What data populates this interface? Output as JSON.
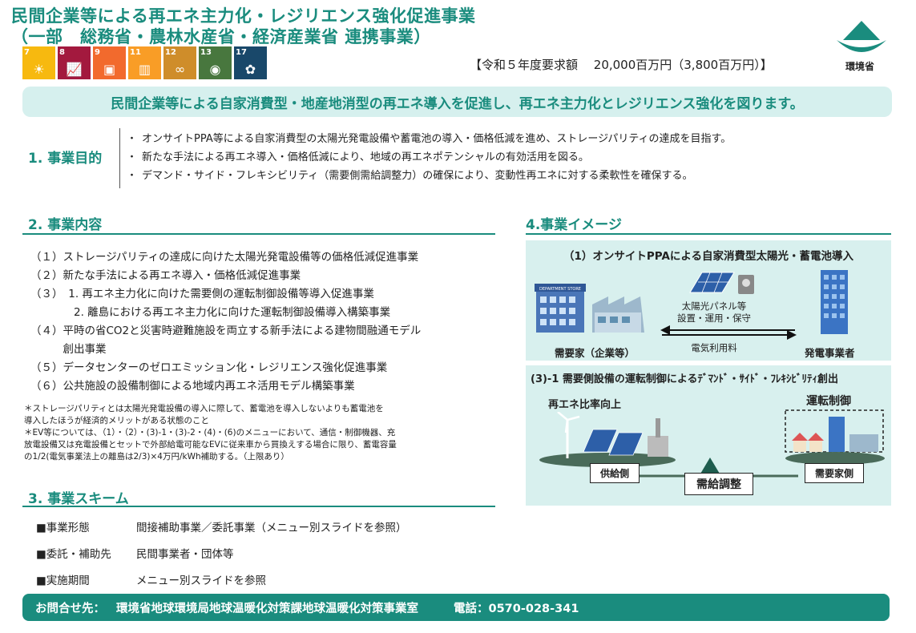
{
  "header": {
    "title_line1": "民間企業等による再エネ主力化・レジリエンス強化促進事業",
    "title_line2": "（一部　総務省・農林水産省・経済産業省 連携事業）",
    "budget": "【令和５年度要求額　 20,000百万円（3,800百万円）】",
    "logo_text": "環境省"
  },
  "sdgs": [
    {
      "num": "7",
      "color": "#f7b90f",
      "glyph": "☀"
    },
    {
      "num": "8",
      "color": "#a3193e",
      "glyph": "📈"
    },
    {
      "num": "9",
      "color": "#f26a2d",
      "glyph": "▣"
    },
    {
      "num": "11",
      "color": "#f99d26",
      "glyph": "▥"
    },
    {
      "num": "12",
      "color": "#cf8d2a",
      "glyph": "∞"
    },
    {
      "num": "13",
      "color": "#48773e",
      "glyph": "◉"
    },
    {
      "num": "17",
      "color": "#19486a",
      "glyph": "✿"
    }
  ],
  "banner": "民間企業等による自家消費型・地産地消型の再エネ導入を促進し、再エネ主力化とレジリエンス強化を図ります。",
  "purpose": {
    "label": "1. 事業目的",
    "bullets": [
      "オンサイトPPA等による自家消費型の太陽光発電設備や蓄電池の導入・価格低減を進め、ストレージパリティの達成を目指す。",
      "新たな手法による再エネ導入・価格低減により、地域の再エネポテンシャルの有効活用を図る。",
      "デマンド・サイド・フレキシビリティ（需要側需給調整力）の確保により、変動性再エネに対する柔軟性を確保する。"
    ]
  },
  "content": {
    "heading": "2. 事業内容",
    "items": [
      "（１）ストレージパリティの達成に向けた太陽光発電設備等の価格低減促進事業",
      "（２）新たな手法による再エネ導入・価格低減促進事業",
      "（３）　1. 再エネ主力化に向けた需要側の運転制御設備等導入促進事業",
      "　　　　2. 離島における再エネ主力化に向けた運転制御設備導入構築事業",
      "（４）平時の省CO2と災害時避難施設を両立する新手法による建物間融通モデル",
      "　　　創出事業",
      "（５）データセンターのゼロエミッション化・レジリエンス強化促進事業",
      "（６）公共施設の設備制御による地域内再エネ活用モデル構築事業"
    ],
    "notes": [
      "＊ストレージパリティとは太陽光発電設備の導入に際して、蓄電池を導入しないよりも蓄電池を",
      "導入したほうが経済的メリットがある状態のこと",
      "＊EV等については、（1）・（2）・(3)-1・(3)-2・(4)・(6)のメニューにおいて、通信・制御機器、充",
      "放電設備又は充電設備とセットで外部給電可能なEVに従来車から買換えする場合に限り、蓄電容量",
      "の1/2(電気事業法上の離島は2/3)×4万円/kWh補助する。（上限あり）"
    ]
  },
  "scheme": {
    "heading": "3. 事業スキーム",
    "rows": [
      {
        "key": "■事業形態",
        "value": "間接補助事業／委託事業（メニュー別スライドを参照）"
      },
      {
        "key": "■委託・補助先",
        "value": "民間事業者・団体等"
      },
      {
        "key": "■実施期間",
        "value": "メニュー別スライドを参照"
      }
    ]
  },
  "image": {
    "heading": "4.事業イメージ",
    "panel1": {
      "title": "（1）オンサイトPPAによる自家消費型太陽光・蓄電池導入",
      "arrow_top": "太陽光パネル等",
      "arrow_top2": "設置・運用・保守",
      "arrow_bottom": "電気利用料",
      "left_label": "需要家（企業等）",
      "right_label": "発電事業者",
      "store_sign": "DEPARTMENT STORE"
    },
    "panel2": {
      "title": "(3)-1 需要側設備の運転制御によるﾃﾞﾏﾝﾄﾞ・ｻｲﾄﾞ・ﾌﾚｷｼﾋﾞﾘﾃｨ創出",
      "left_caption": "再エネ比率向上",
      "right_caption": "運転制御",
      "supply": "供給側",
      "demand": "需要家側",
      "balance": "需給調整"
    }
  },
  "contact": {
    "label": "お問合せ先：",
    "org": "環境省地球環境局地球温暖化対策課地球温暖化対策事業室",
    "tel": "電話：0570-028-341"
  }
}
